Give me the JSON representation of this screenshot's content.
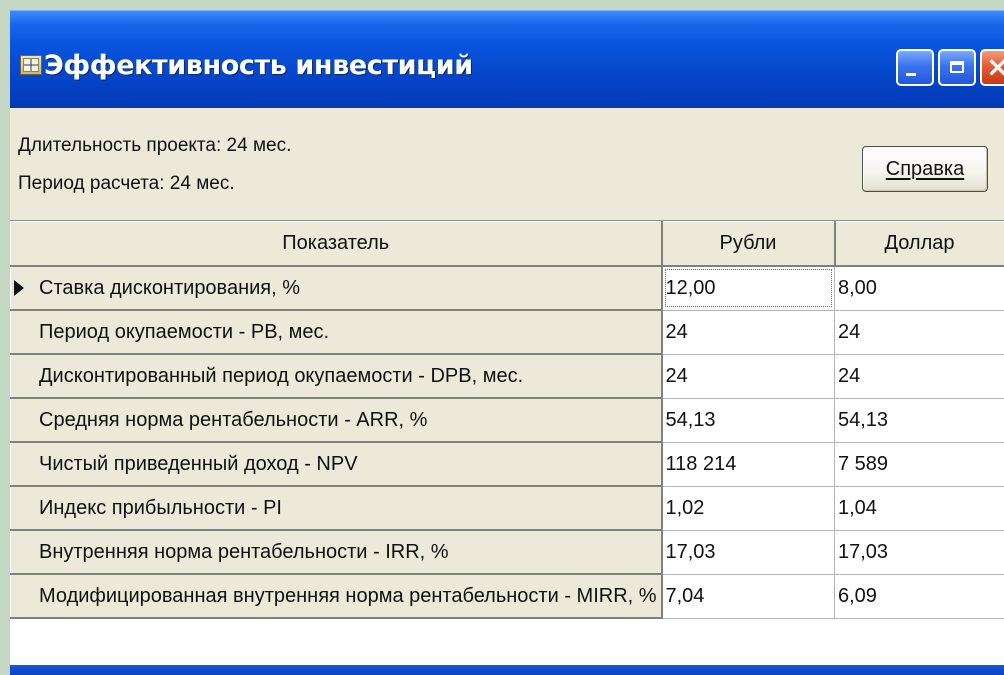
{
  "window": {
    "title": "Эффективность инвестиций",
    "title_bar_color": "#0a55df",
    "controls": {
      "minimize_icon": "minimize-icon",
      "maximize_icon": "maximize-icon",
      "close_icon": "close-icon"
    }
  },
  "info": {
    "project_duration": "Длительность проекта: 24 мес.",
    "calculation_period": "Период расчета: 24 мес."
  },
  "help_button": {
    "label": "Справка"
  },
  "table": {
    "columns": [
      "Показатель",
      "Рубли",
      "Доллар"
    ],
    "rows": [
      {
        "indicator": "Ставка дисконтирования, %",
        "rubles": "12,00",
        "dollars": "8,00"
      },
      {
        "indicator": "Период окупаемости - PB, мес.",
        "rubles": "24",
        "dollars": "24"
      },
      {
        "indicator": "Дисконтированный период окупаемости - DPB, мес.",
        "rubles": "24",
        "dollars": "24"
      },
      {
        "indicator": "Средняя норма рентабельности - ARR, %",
        "rubles": "54,13",
        "dollars": "54,13"
      },
      {
        "indicator": "Чистый приведенный доход - NPV",
        "rubles": "118 214",
        "dollars": "7 589"
      },
      {
        "indicator": "Индекс прибыльности - PI",
        "rubles": "1,02",
        "dollars": "1,04"
      },
      {
        "indicator": "Внутренняя норма рентабельности - IRR, %",
        "rubles": "17,03",
        "dollars": "17,03"
      },
      {
        "indicator": "Модифицированная внутренняя норма рентабельности - MIRR, %",
        "rubles": "7,04",
        "dollars": "6,09"
      }
    ]
  }
}
